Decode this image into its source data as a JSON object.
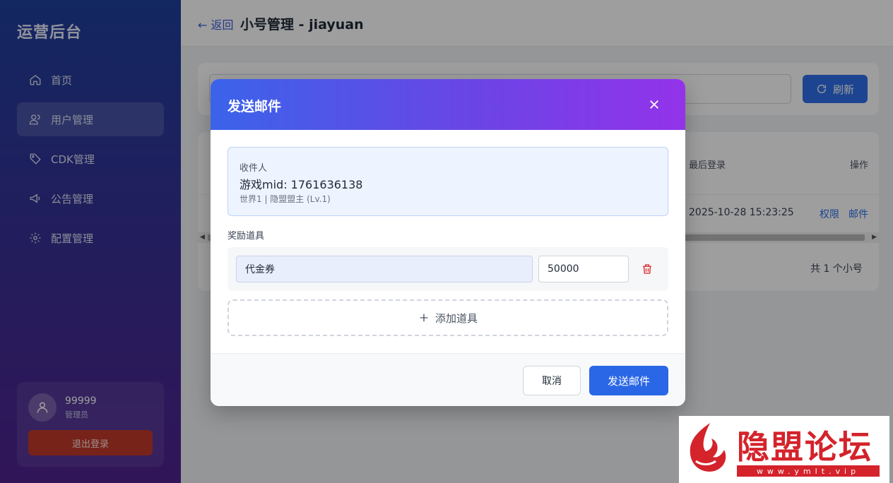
{
  "sidebar": {
    "brand": "运营后台",
    "items": [
      {
        "label": "首页",
        "icon": "home-icon"
      },
      {
        "label": "用户管理",
        "icon": "users-icon",
        "active": true
      },
      {
        "label": "CDK管理",
        "icon": "tag-icon"
      },
      {
        "label": "公告管理",
        "icon": "megaphone-icon"
      },
      {
        "label": "配置管理",
        "icon": "gear-icon"
      }
    ],
    "user": {
      "name": "99999",
      "role": "管理员",
      "logout_label": "退出登录"
    }
  },
  "header": {
    "back_label": "← 返回",
    "title": "小号管理 - jiayuan"
  },
  "toolbar": {
    "refresh_label": "刷新"
  },
  "table": {
    "columns": {
      "last_login": "最后登录",
      "actions": "操作"
    },
    "rows": [
      {
        "last_login": "2025-10-28 15:23:25",
        "action_permission": "权限",
        "action_mail": "邮件"
      }
    ],
    "count_text": "共 1 个小号"
  },
  "modal": {
    "title": "发送邮件",
    "recipient": {
      "label": "收件人",
      "value": "游戏mid: 1761636138",
      "sub": "世界1 | 隐盟盟主 (Lv.1)"
    },
    "reward_label": "奖励道具",
    "rewards": [
      {
        "item": "代金券",
        "quantity": "50000"
      }
    ],
    "add_item_label": "添加道具",
    "cancel_label": "取消",
    "send_label": "发送邮件"
  },
  "watermark": {
    "text": "隐盟论坛",
    "url": "www.ymlt.vip"
  },
  "colors": {
    "primary": "#2f6fe8",
    "danger": "#dc2626",
    "logout": "#c0392b",
    "watermark": "#d4232b"
  }
}
